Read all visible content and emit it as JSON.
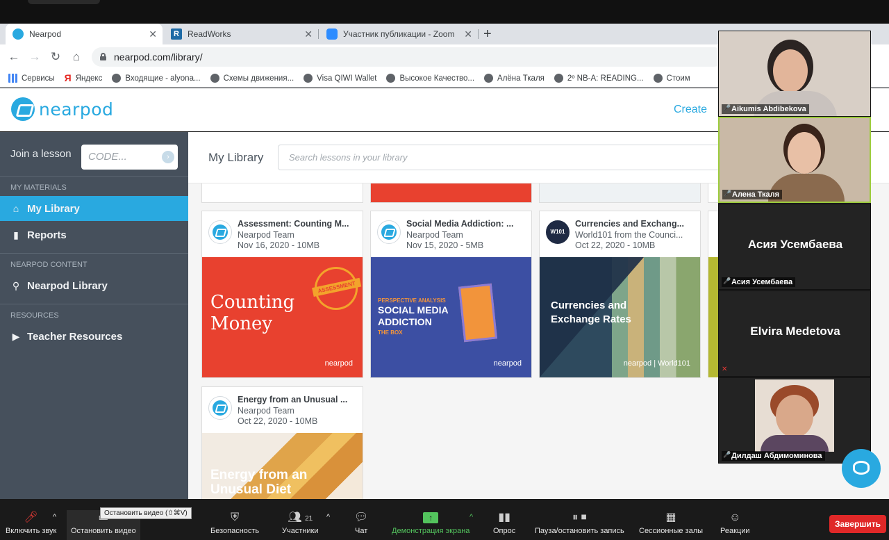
{
  "browser": {
    "tabs": [
      {
        "label": "Nearpod",
        "color": "#29a9e0"
      },
      {
        "label": "ReadWorks",
        "color": "#1d6aa5"
      },
      {
        "label": "Участник публикации - Zoom",
        "color": "#2d8cff"
      }
    ],
    "url": "nearpod.com/library/",
    "bookmarks": [
      {
        "label": "Сервисы",
        "icon": "apps-grid-icon"
      },
      {
        "label": "Яндекс",
        "icon": "yandex-icon"
      },
      {
        "label": "Входящие - alyona...",
        "icon": "globe-icon"
      },
      {
        "label": "Схемы движения...",
        "icon": "globe-icon"
      },
      {
        "label": "Visa QIWI Wallet",
        "icon": "globe-icon"
      },
      {
        "label": "Высокое Качество...",
        "icon": "globe-icon"
      },
      {
        "label": "Алёна Ткаля",
        "icon": "globe-icon"
      },
      {
        "label": "2º NB-A: READING...",
        "icon": "globe-icon"
      },
      {
        "label": "Стоим",
        "icon": "globe-icon"
      }
    ]
  },
  "nearpod": {
    "logo_text": "nearpod",
    "create_label": "Create",
    "sidebar": {
      "join_label": "Join a lesson",
      "code_placeholder": "CODE...",
      "sections": [
        {
          "header": "MY MATERIALS",
          "items": [
            {
              "label": "My Library",
              "icon": "home-icon",
              "active": true
            },
            {
              "label": "Reports",
              "icon": "bar-chart-icon"
            }
          ]
        },
        {
          "header": "NEARPOD CONTENT",
          "items": [
            {
              "label": "Nearpod Library",
              "icon": "search-icon"
            }
          ]
        },
        {
          "header": "RESOURCES",
          "items": [
            {
              "label": "Teacher Resources",
              "icon": "play-icon"
            }
          ]
        }
      ]
    },
    "main": {
      "title": "My Library",
      "search_placeholder": "Search lessons in your library",
      "cards": [
        {
          "title": "Assessment: Counting M...",
          "author": "Nearpod Team",
          "meta": "Nov 16, 2020 - 10MB",
          "cover_text": "Counting Money",
          "badge": "ASSESSMENT",
          "brand": "nearpod"
        },
        {
          "title": "Social Media Addiction: ...",
          "author": "Nearpod Team",
          "meta": "Nov 15, 2020 - 5MB",
          "cover_kicker": "PERSPECTIVE ANALYSIS",
          "cover_text": "SOCIAL MEDIA ADDICTION",
          "cover_sub": "THE BOX",
          "brand": "nearpod"
        },
        {
          "title": "Currencies and Exchang...",
          "author": "World101 from the Counci...",
          "meta": "Oct 22, 2020 - 10MB",
          "avatar_text": "W101",
          "cover_text": "Currencies and Exchange Rates",
          "brand": "nearpod | World101"
        },
        {
          "title": "Energy from an Unusual ...",
          "author": "Nearpod Team",
          "meta": "Oct 22, 2020 - 10MB",
          "cover_text": "Energy from an Unusual Diet"
        }
      ]
    }
  },
  "zoom": {
    "participants": [
      {
        "name": "Aikumis Abdibekova",
        "video": true
      },
      {
        "name": "Алена Ткаля",
        "video": true,
        "active": true
      },
      {
        "name": "Асия Усембаева",
        "video": false
      },
      {
        "name": "Elvira Medetova",
        "video": false
      },
      {
        "name": "Дилдаш Абдимоминова",
        "video": true
      }
    ],
    "toolbar": {
      "mute": "Включить звук",
      "stop_video": "Остановить видео",
      "tooltip": "Остановить видео (⇧⌘V)",
      "security": "Безопасность",
      "participants": "Участники",
      "participants_count": "21",
      "chat": "Чат",
      "share": "Демонстрация экрана",
      "poll": "Опрос",
      "record": "Пауза/остановить запись",
      "breakout": "Сессионные залы",
      "reactions": "Реакции",
      "end": "Завершить"
    }
  }
}
